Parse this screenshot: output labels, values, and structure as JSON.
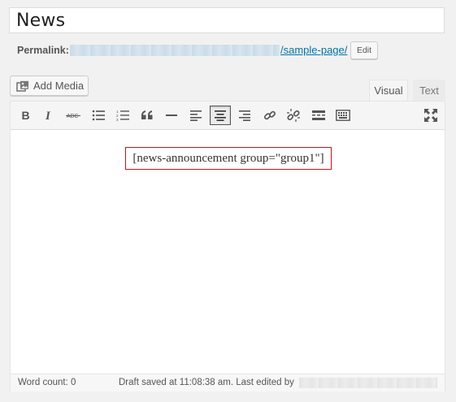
{
  "post": {
    "title": "News"
  },
  "permalink": {
    "label": "Permalink:",
    "url_tail": "/sample-page/",
    "edit_label": "Edit"
  },
  "media": {
    "add_media_label": "Add Media"
  },
  "editor_tabs": {
    "visual": "Visual",
    "text": "Text",
    "active": "Visual"
  },
  "toolbar": {
    "buttons": [
      {
        "name": "bold",
        "icon": "bold-icon"
      },
      {
        "name": "italic",
        "icon": "italic-icon"
      },
      {
        "name": "strikethrough",
        "icon": "strikethrough-icon"
      },
      {
        "name": "bulleted-list",
        "icon": "bulleted-list-icon"
      },
      {
        "name": "numbered-list",
        "icon": "numbered-list-icon"
      },
      {
        "name": "blockquote",
        "icon": "blockquote-icon"
      },
      {
        "name": "horizontal-line",
        "icon": "horizontal-line-icon"
      },
      {
        "name": "align-left",
        "icon": "align-left-icon"
      },
      {
        "name": "align-center",
        "icon": "align-center-icon",
        "active": true
      },
      {
        "name": "align-right",
        "icon": "align-right-icon"
      },
      {
        "name": "insert-link",
        "icon": "link-icon"
      },
      {
        "name": "remove-link",
        "icon": "unlink-icon"
      },
      {
        "name": "read-more",
        "icon": "read-more-icon"
      },
      {
        "name": "toolbar-toggle",
        "icon": "keyboard-icon"
      },
      {
        "name": "fullscreen",
        "icon": "fullscreen-icon"
      }
    ]
  },
  "content": {
    "shortcode": "[news-announcement group=\"group1\"]"
  },
  "status": {
    "word_count_label": "Word count:",
    "word_count": "0",
    "draft_text": "Draft saved at 11:08:38 am. Last edited by"
  },
  "colors": {
    "link": "#0073aa",
    "shortcode_border": "#c0151b",
    "background": "#f1f1f1"
  }
}
